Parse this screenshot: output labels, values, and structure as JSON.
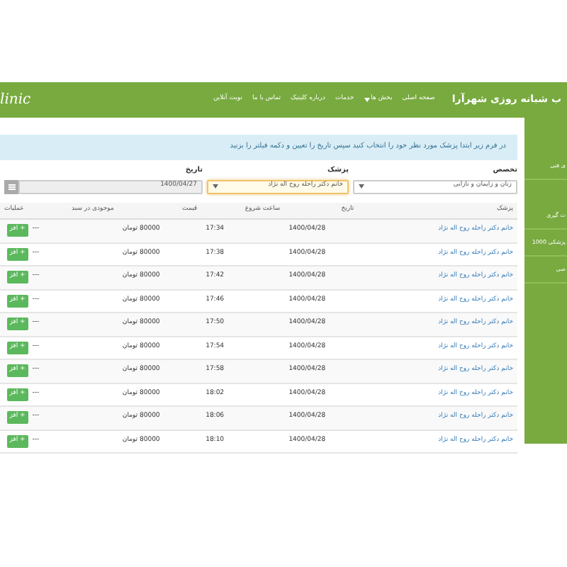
{
  "header": {
    "logo": "linic",
    "title": "ب شبانه روزی شهرآرا",
    "nav": [
      {
        "label": "صفحه اصلی",
        "dropdown": false
      },
      {
        "label": "بخش ها",
        "dropdown": true
      },
      {
        "label": "خدمات",
        "dropdown": false
      },
      {
        "label": "درباره کلینیک",
        "dropdown": false
      },
      {
        "label": "تماس با ما",
        "dropdown": false
      },
      {
        "label": "نوبت آنلاین",
        "dropdown": false
      }
    ]
  },
  "sidebar": {
    "items": [
      "ی فنی",
      "ت گیری",
      "پزشکی 1000",
      "صی"
    ]
  },
  "alert": "در فرم زیر ابتدا پزشک مورد نظر خود را انتخاب کنید سپس تاریخ را تعیین و دکمه فیلتر را بزنید",
  "filters": [
    {
      "kind": "select",
      "label": "تخصص",
      "value": "زنان و زایمان و نازایی",
      "focused": false
    },
    {
      "kind": "select",
      "label": "پزشک",
      "value": "خانم دکتر راحله روح اله نژاد",
      "focused": true
    },
    {
      "kind": "date",
      "label": "تاریخ",
      "value": "1400/04/27",
      "focused": false
    }
  ],
  "table": {
    "columns": [
      "پزشک",
      "تاریخ",
      "ساعت شروع",
      "قیمت",
      "موجودی در سبد",
      "عملیات"
    ],
    "rows": [
      {
        "doctor": "خانم دکتر راحله روح اله نژاد",
        "date": "1400/04/28",
        "time": "17:34",
        "price": "80000 تومان",
        "stock": "---",
        "action": "+ افز"
      },
      {
        "doctor": "خانم دکتر راحله روح اله نژاد",
        "date": "1400/04/28",
        "time": "17:38",
        "price": "80000 تومان",
        "stock": "---",
        "action": "+ افز"
      },
      {
        "doctor": "خانم دکتر راحله روح اله نژاد",
        "date": "1400/04/28",
        "time": "17:42",
        "price": "80000 تومان",
        "stock": "---",
        "action": "+ افز"
      },
      {
        "doctor": "خانم دکتر راحله روح اله نژاد",
        "date": "1400/04/28",
        "time": "17:46",
        "price": "80000 تومان",
        "stock": "---",
        "action": "+ افز"
      },
      {
        "doctor": "خانم دکتر راحله روح اله نژاد",
        "date": "1400/04/28",
        "time": "17:50",
        "price": "80000 تومان",
        "stock": "---",
        "action": "+ افز"
      },
      {
        "doctor": "خانم دکتر راحله روح اله نژاد",
        "date": "1400/04/28",
        "time": "17:54",
        "price": "80000 تومان",
        "stock": "---",
        "action": "+ افز"
      },
      {
        "doctor": "خانم دکتر راحله روح اله نژاد",
        "date": "1400/04/28",
        "time": "17:58",
        "price": "80000 تومان",
        "stock": "---",
        "action": "+ افز"
      },
      {
        "doctor": "خانم دکتر راحله روح اله نژاد",
        "date": "1400/04/28",
        "time": "18:02",
        "price": "80000 تومان",
        "stock": "---",
        "action": "+ افز"
      },
      {
        "doctor": "خانم دکتر راحله روح اله نژاد",
        "date": "1400/04/28",
        "time": "18:06",
        "price": "80000 تومان",
        "stock": "---",
        "action": "+ افز"
      },
      {
        "doctor": "خانم دکتر راحله روح اله نژاد",
        "date": "1400/04/28",
        "time": "18:10",
        "price": "80000 تومان",
        "stock": "---",
        "action": "+ افز"
      }
    ]
  }
}
